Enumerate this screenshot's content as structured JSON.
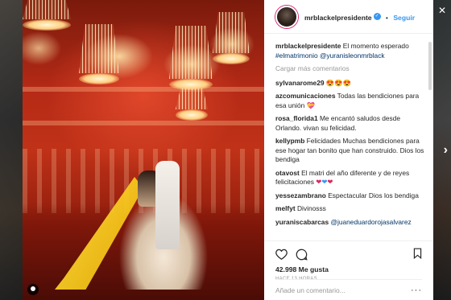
{
  "header": {
    "username": "mrblackelpresidente",
    "separator": "•",
    "follow_label": "Seguir"
  },
  "caption": {
    "username": "mrblackelpresidente",
    "text": "El momento esperado",
    "hashtag": "#elmatrimonio",
    "mentions": "@yuranisleonmrblack"
  },
  "load_more_label": "Cargar más comentarios",
  "comments": [
    {
      "user": "sylvanarome29",
      "text": "😍😍😍"
    },
    {
      "user": "azcomunicaciones",
      "text": "Todas las bendiciones para esa unión"
    },
    {
      "user": "rosa_florida1",
      "text": "Me encantó saludos desde Orlando. vivan su felicidad."
    },
    {
      "user": "kellypmb",
      "text": "Felicidades Muchas bendiciones para ese hogar tan bonito que han construido. Dios los bendiga"
    },
    {
      "user": "otavost",
      "text": "El matri del año diferente y de reyes felicitaciones"
    },
    {
      "user": "yessezambrano",
      "text": "Espectacular Dios los bendiga"
    },
    {
      "user": "melfyt",
      "text": "Divinosss"
    },
    {
      "user": "yuraniscabarcas",
      "text": "@juaneduardorojasalvarez"
    }
  ],
  "actions": {
    "likes": "42.998 Me gusta",
    "time": "HACE 13 HORAS"
  },
  "add_comment": {
    "placeholder": "Añade un comentario...",
    "more": "···"
  },
  "icons": [
    "heart-icon",
    "comment-icon",
    "save-icon",
    "verified-icon",
    "close-icon",
    "next-arrow-icon",
    "user-tag-icon"
  ],
  "colors": {
    "accent": "#3897f0",
    "text": "#262626",
    "muted": "#999999",
    "link": "#003569"
  }
}
